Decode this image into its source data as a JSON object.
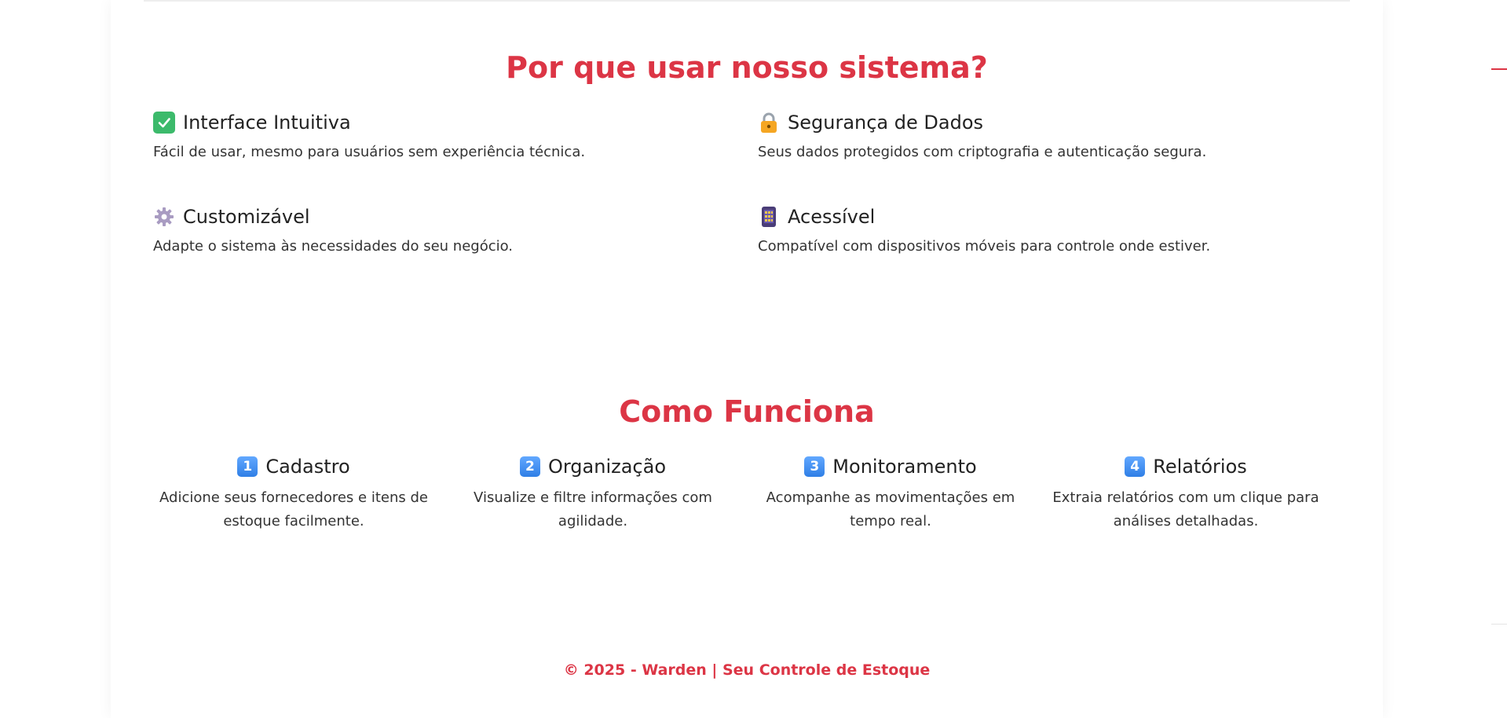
{
  "sections": {
    "why": {
      "title": "Por que usar nosso sistema?",
      "features": [
        {
          "icon": "check-mark-icon",
          "title": "Interface Intuitiva",
          "desc": "Fácil de usar, mesmo para usuários sem experiência técnica."
        },
        {
          "icon": "padlock-icon",
          "title": "Segurança de Dados",
          "desc": "Seus dados protegidos com criptografia e autenticação segura."
        },
        {
          "icon": "gear-icon",
          "title": "Customizável",
          "desc": "Adapte o sistema às necessidades do seu negócio."
        },
        {
          "icon": "mobile-phone-icon",
          "title": "Acessível",
          "desc": "Compatível com dispositivos móveis para controle onde estiver."
        }
      ]
    },
    "how": {
      "title": "Como Funciona",
      "steps": [
        {
          "num": "1",
          "title": "Cadastro",
          "desc": "Adicione seus fornecedores e itens de estoque facilmente."
        },
        {
          "num": "2",
          "title": "Organização",
          "desc": "Visualize e filtre informações com agilidade."
        },
        {
          "num": "3",
          "title": "Monitoramento",
          "desc": "Acompanhe as movimentações em tempo real."
        },
        {
          "num": "4",
          "title": "Relatórios",
          "desc": "Extraia relatórios com um clique para análises detalhadas."
        }
      ]
    }
  },
  "footer": {
    "text": "© 2025 - Warden | Seu Controle de Estoque"
  },
  "colors": {
    "accent": "#dc3545",
    "background": "#ffffff"
  }
}
